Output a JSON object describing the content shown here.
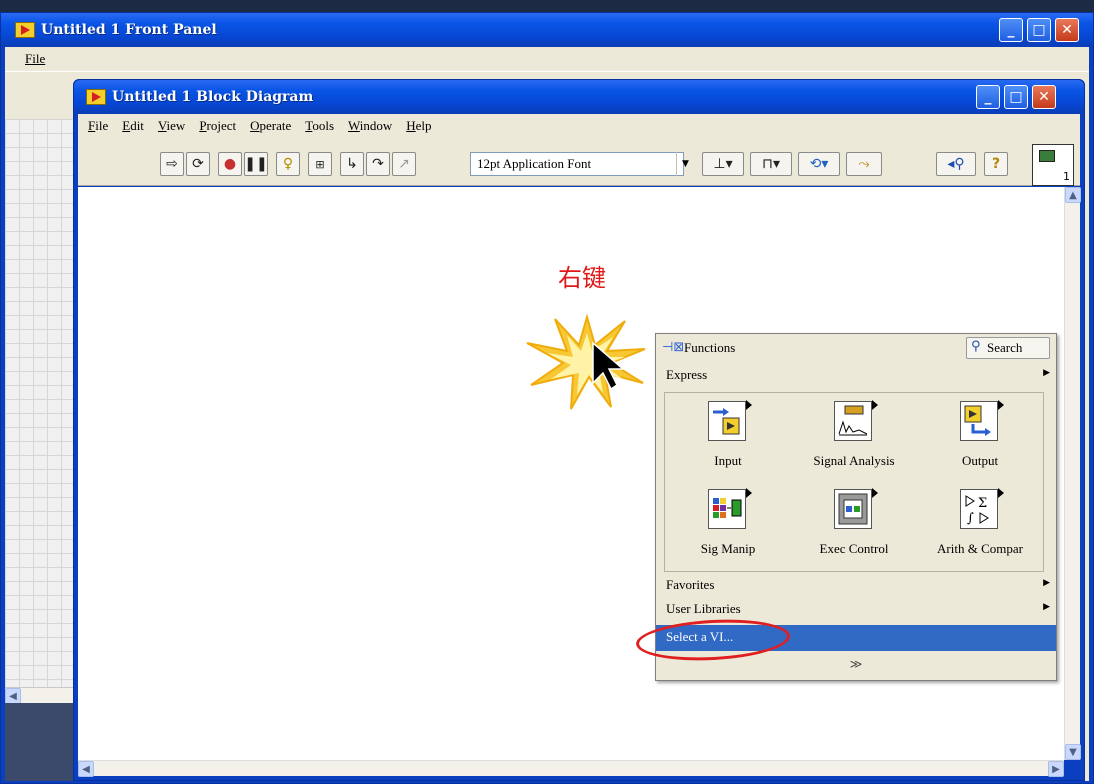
{
  "front_panel": {
    "title": "Untitled 1 Front Panel",
    "menu_file": "File"
  },
  "block_diagram": {
    "title": "Untitled 1 Block Diagram",
    "menu": [
      "File",
      "Edit",
      "View",
      "Project",
      "Operate",
      "Tools",
      "Window",
      "Help"
    ],
    "toolbar": {
      "font": "12pt Application Font",
      "buttons": [
        "run-arrow-icon",
        "run-continuous-icon",
        "abort-icon",
        "pause-icon",
        "highlight-execution-icon",
        "retain-wire-values-icon",
        "step-into-icon",
        "step-over-icon",
        "step-out-icon",
        "align-icon",
        "distribute-icon",
        "reorder-icon",
        "cleanup-icon",
        "zoom-icon",
        "help-icon"
      ]
    },
    "vi_icon_number": "1"
  },
  "annotation": {
    "text": "右键",
    "color": "#e01818"
  },
  "functions_palette": {
    "title": "Functions",
    "search_label": "Search",
    "express_label": "Express",
    "tiles": [
      {
        "label": "Input",
        "icon": "input-icon"
      },
      {
        "label": "Signal Analysis",
        "icon": "signal-analysis-icon"
      },
      {
        "label": "Output",
        "icon": "output-icon"
      },
      {
        "label": "Sig Manip",
        "icon": "sig-manip-icon"
      },
      {
        "label": "Exec Control",
        "icon": "exec-control-icon"
      },
      {
        "label": "Arith & Compar",
        "icon": "arith-compar-icon"
      }
    ],
    "favorites_label": "Favorites",
    "user_libraries_label": "User Libraries",
    "select_vi_label": "Select a VI...",
    "selection_color": "#316ac5"
  }
}
